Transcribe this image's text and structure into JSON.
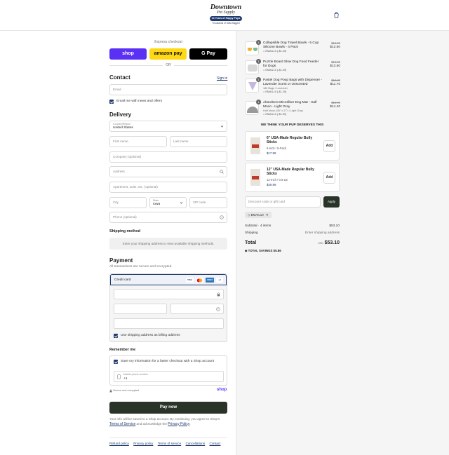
{
  "header": {
    "logo_line1": "Downtown",
    "logo_line2": "Pet Supply",
    "logo_badge": "10 Years of Happy Pups",
    "logo_line3": "Thousands of Tails Wagged"
  },
  "express": {
    "label": "Express checkout",
    "shop_label": "shop",
    "amazon_label": "amazon pay",
    "gpay_label": "G Pay",
    "or_label": "OR"
  },
  "contact": {
    "heading": "Contact",
    "signin": "Sign in",
    "email_placeholder": "Email",
    "news_label": "Email me with news and offers"
  },
  "delivery": {
    "heading": "Delivery",
    "country_label": "Country/Region",
    "country_value": "United States",
    "first_name": "First name",
    "last_name": "Last name",
    "company": "Company (optional)",
    "address": "Address",
    "apartment": "Apartment, suite, etc. (optional)",
    "city": "City",
    "state_label": "State",
    "state_value": "Iowa",
    "zip": "ZIP code",
    "phone": "Phone (optional)"
  },
  "shipping": {
    "heading": "Shipping method",
    "note": "Enter your shipping address to view available shipping methods."
  },
  "payment": {
    "heading": "Payment",
    "subtitle": "All transactions are secure and encrypted.",
    "method_label": "Credit card",
    "card_icons": [
      "VISA",
      "MC",
      "AMEX",
      "+4"
    ],
    "billing_label": "Use shipping address as billing address"
  },
  "remember": {
    "heading": "Remember me",
    "save_label": "Save my information for a faster checkout with a Shop account",
    "phone_label": "Mobile phone number",
    "phone_prefix": "+1",
    "secure_label": "Secure and encrypted",
    "shop_brand": "shop"
  },
  "pay": {
    "button": "Pay now",
    "terms_text": "Your info will be saved to a Shop account. By continuing, you agree to Shop's",
    "terms_link": "Terms of Service",
    "and_text": "and acknowledge the",
    "privacy_link": "Privacy Policy",
    "period": "."
  },
  "footer": {
    "links": [
      "Refund policy",
      "Privacy policy",
      "Terms of service",
      "Cancellations",
      "Contact"
    ]
  },
  "cart": {
    "items": [
      {
        "qty": "1",
        "name": "Collapsible Dog Travel Bowls - 5 Cup Silicone Bowls - 4 Pack",
        "variant": "",
        "code": "EMAIL10 (-$1.49)",
        "old_price": "$14.99",
        "price": "$13.50"
      },
      {
        "qty": "1",
        "name": "Puzzle Board Slow Dog Food Feeder for Dogs",
        "variant": "",
        "code": "EMAIL10 (-$1.49)",
        "old_price": "$14.99",
        "price": "$13.50"
      },
      {
        "qty": "1",
        "name": "Pastel Dog Poop Bags with Dispenser - Lavender Scent or Unscented",
        "variant": "180 Bags / Lavender",
        "code": "EMAIL10 (-$1.29)",
        "old_price": "$12.99",
        "price": "$11.70"
      },
      {
        "qty": "1",
        "name": "Absorbent Microfiber Dog Mat - Half Moon - Light Gray",
        "variant": "Half Moon (35\" x 27\") / Light Gray",
        "code": "EMAIL10 (-$1.59)",
        "old_price": "$15.99",
        "price": "$14.40"
      }
    ],
    "upsell_heading": "WE THINK YOUR PUP DESERVES THIS",
    "upsells": [
      {
        "name": "6\" USA-Made Regular Bully Sticks",
        "variant": "6-Inch / 5-Pack",
        "price": "$17.99",
        "add": "Add"
      },
      {
        "name": "12\" USA-Made Regular Bully Sticks",
        "variant": "12-Inch / 0.5-LB",
        "price": "$29.99",
        "add": "Add"
      }
    ],
    "discount_placeholder": "Discount code or gift card",
    "apply": "Apply",
    "applied_code": "EMAIL10",
    "subtotal_label": "Subtotal · 4 items",
    "subtotal_value": "$53.10",
    "shipping_label": "Shipping",
    "shipping_value": "Enter shipping address",
    "total_label": "Total",
    "currency": "USD",
    "total_value": "$53.10",
    "savings_label": "TOTAL SAVINGS",
    "savings_value": "$5.86"
  },
  "colors": {
    "brand_navy": "#1f3a6e",
    "shop_purple": "#5a31f4",
    "amazon_yellow": "#ffd814",
    "pay_button": "#2a3328"
  }
}
